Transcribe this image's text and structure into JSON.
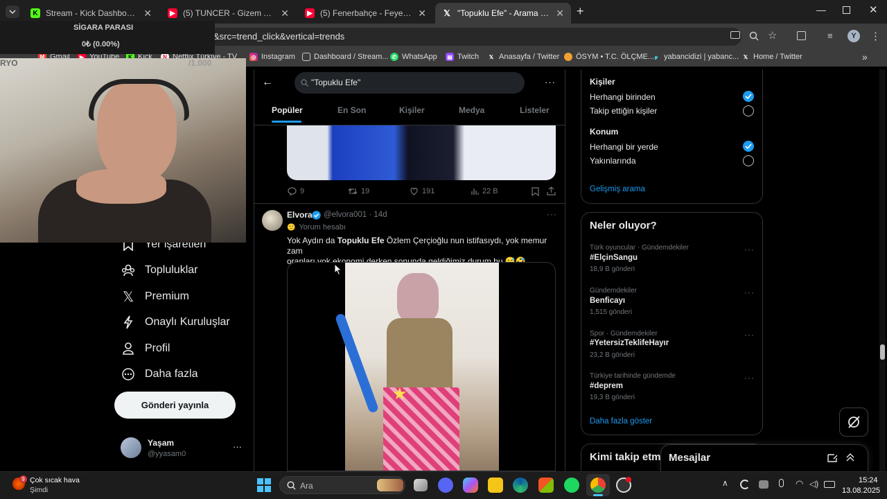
{
  "browser": {
    "tabs": [
      {
        "title": "Stream - Kick Dashboard",
        "favicon": "kick-icon"
      },
      {
        "title": "(5) TUNCER - Gizem Avcısı - Yo",
        "favicon": "youtube-icon"
      },
      {
        "title": "(5) Fenerbahçe - Feyenoord (5-",
        "favicon": "youtube-icon"
      },
      {
        "title": "\"Topuklu Efe\" - Arama / X",
        "favicon": "x-icon"
      }
    ],
    "url_fragment": "&src=trend_click&vertical=trends",
    "bookmarks": [
      "Gmail",
      "YouTube",
      "Kick",
      "Netflix Türkiye - TV",
      "Instagram",
      "Dashboard / Stream...",
      "WhatsApp",
      "Twitch",
      "Anasayfa / Twitter",
      "ÖSYM • T.C. ÖLÇME...",
      "yabancidizi | yabanc...",
      "Home / Twitter"
    ],
    "profile_initial": "Y"
  },
  "overlay": {
    "label": "SİGARA PARASI",
    "value": "0₺ (0.00%)",
    "side_left": "RYO",
    "side_right": "/1.000"
  },
  "nav": {
    "items": [
      "Yer işaretleri",
      "Topluluklar",
      "Premium",
      "Onaylı Kuruluşlar",
      "Profil",
      "Daha fazla"
    ],
    "post_button": "Gönderi yayınla",
    "user_name": "Yaşam",
    "user_handle": "@yyasam0",
    "more": "···"
  },
  "search": {
    "query": "\"Topuklu Efe\"",
    "tabs": [
      "Popüler",
      "En Son",
      "Kişiler",
      "Medya",
      "Listeler"
    ]
  },
  "prev_tweet": {
    "replies": "9",
    "retweets": "19",
    "likes": "191",
    "views": "22 B"
  },
  "tweet": {
    "name": "Elvora",
    "handle": "@elvora001",
    "time": "· 14d",
    "sub": "Yorum hesabı",
    "text_line1_pre": "Yok Aydın da ",
    "text_bold": "Topuklu Efe",
    "text_line1_post": " Özlem Çerçioğlu nun istifasıydı, yok memur zam",
    "text_line2": "oranları yok ekonomi derken sonunda geldiğimiz durum bu.😅🤣",
    "more": "···"
  },
  "filters": {
    "people_title": "Kişiler",
    "people_opts": [
      "Herhangi birinden",
      "Takip ettiğin kişiler"
    ],
    "location_title": "Konum",
    "location_opts": [
      "Herhangi bir yerde",
      "Yakınlarında"
    ],
    "advanced": "Gelişmiş arama"
  },
  "trends": {
    "title": "Neler oluyor?",
    "items": [
      {
        "meta": "Türk oyuncular · Gündemdekiler",
        "name": "#ElçinSangu",
        "count": "18,9 B gönderi"
      },
      {
        "meta": "Gündemdekiler",
        "name": "Benficayı",
        "count": "1,515 gönderi"
      },
      {
        "meta": "Spor · Gündemdekiler",
        "name": "#YetersizTeklifeHayır",
        "count": "23,2 B gönderi"
      },
      {
        "meta": "Türkiye tarihinde gündemde",
        "name": "#deprem",
        "count": "19,3 B gönderi"
      }
    ],
    "show_more": "Daha fazla göster",
    "more": "···"
  },
  "who_to_follow": "Kimi takip etm",
  "messages": "Mesajlar",
  "taskbar": {
    "weather": "Çok sıcak hava",
    "weather_sub": "Şimdi",
    "weather_badge": "9",
    "search_placeholder": "Ara",
    "time": "15:24",
    "date": "13.08.2025"
  },
  "colors": {
    "accent": "#1d9bf0",
    "bg": "#000000",
    "border": "#2f3336",
    "muted": "#71767b"
  }
}
